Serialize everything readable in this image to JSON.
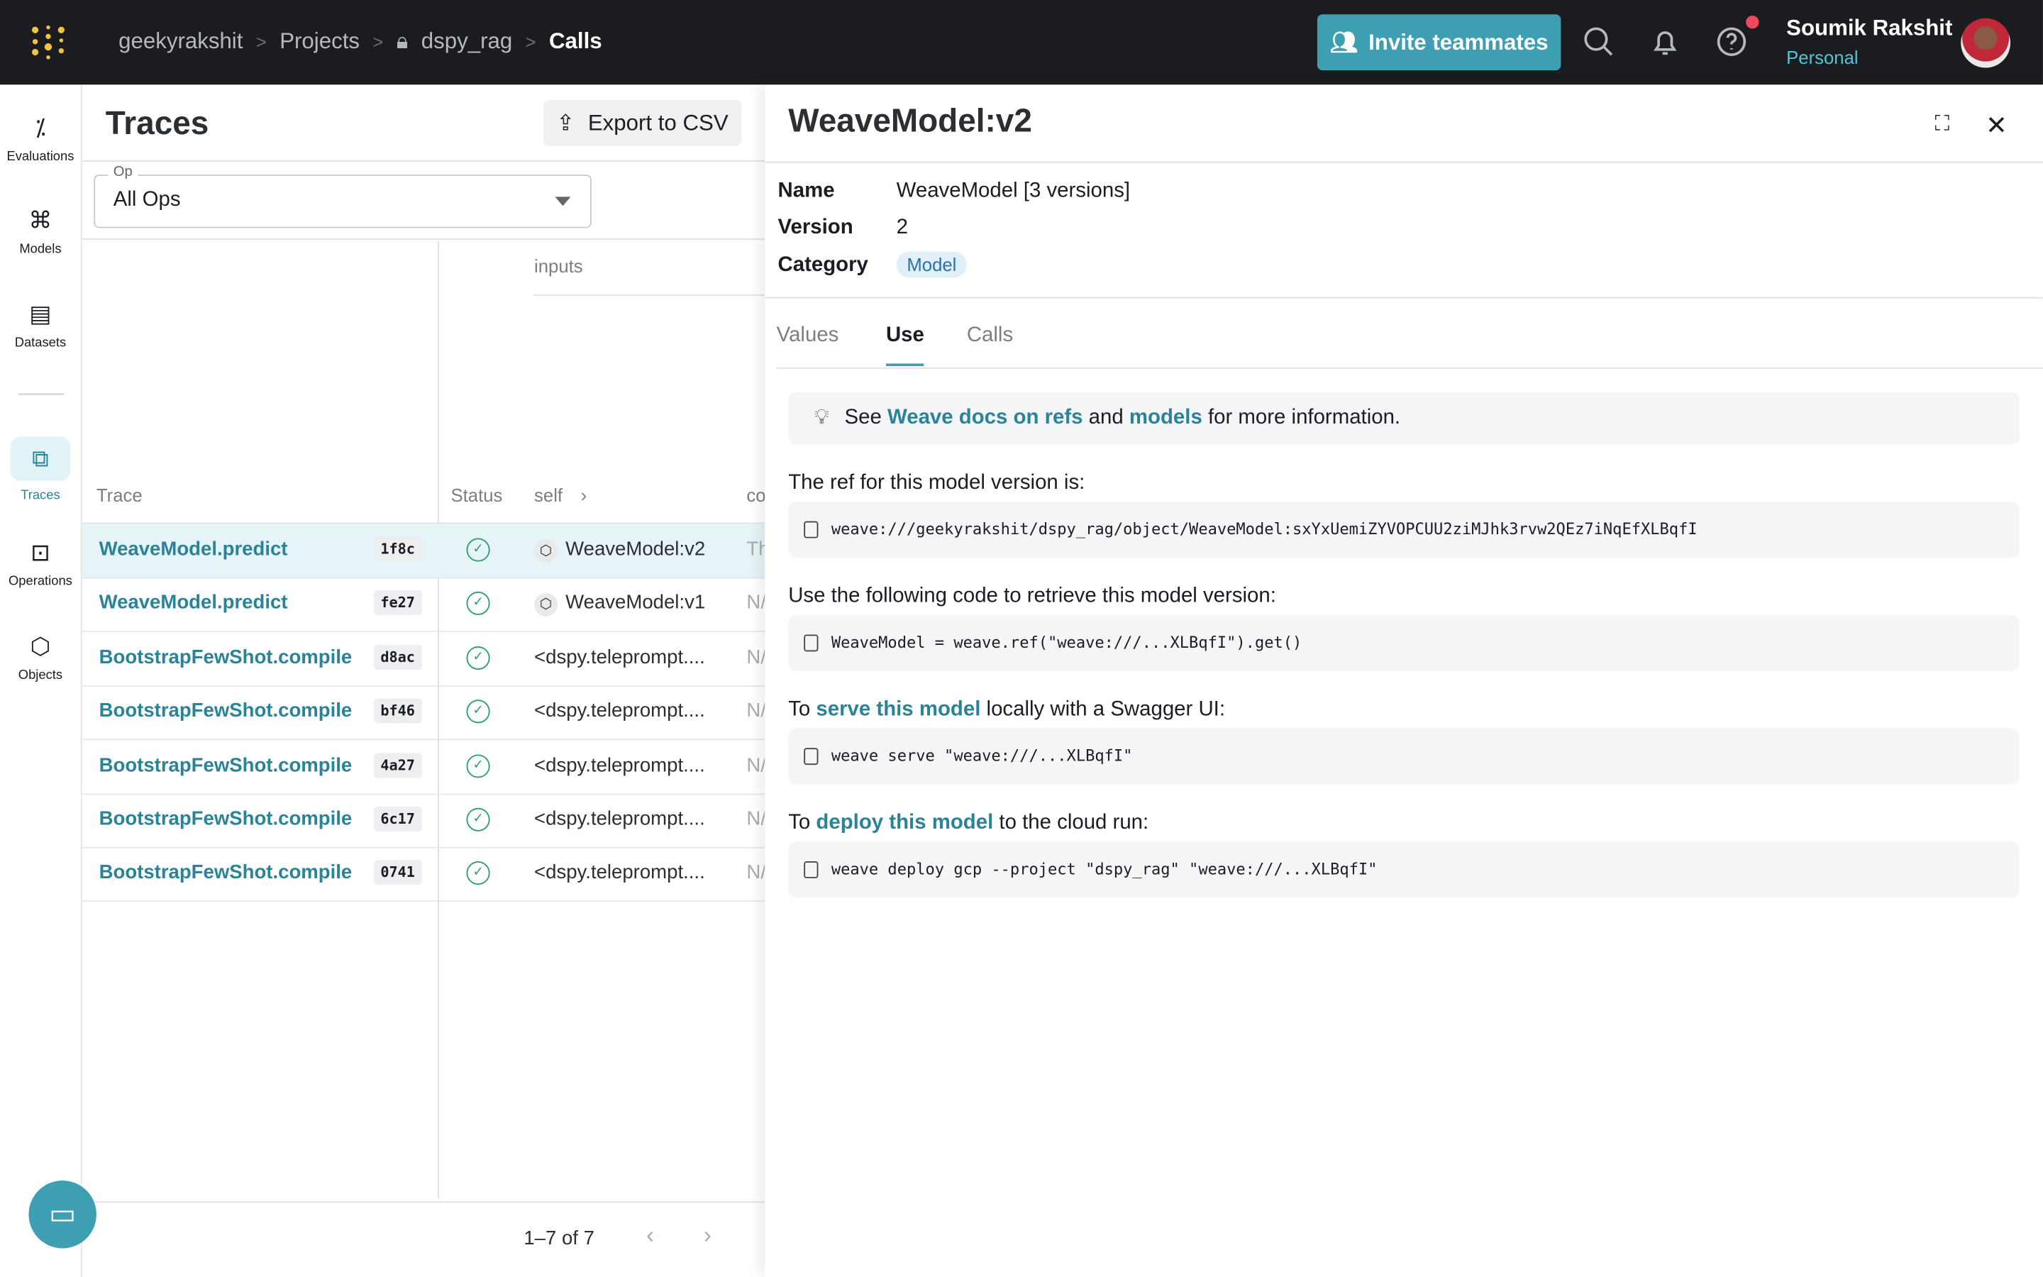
{
  "topbar": {
    "breadcrumbs": [
      "geekyrakshit",
      "Projects",
      "dspy_rag",
      "Calls"
    ],
    "invite_label": "Invite teammates",
    "user_name": "Soumik Rakshit",
    "user_sub": "Personal"
  },
  "sidebar": {
    "items": [
      {
        "label": "Evaluations",
        "icon": "evaluations-icon"
      },
      {
        "label": "Models",
        "icon": "models-icon"
      },
      {
        "label": "Datasets",
        "icon": "datasets-icon"
      },
      {
        "label": "Traces",
        "icon": "traces-icon",
        "active": true
      },
      {
        "label": "Operations",
        "icon": "operations-icon"
      },
      {
        "label": "Objects",
        "icon": "objects-icon"
      }
    ]
  },
  "traces": {
    "title": "Traces",
    "export_label": "Export to CSV",
    "op_label": "Op",
    "op_value": "All Ops",
    "columns": {
      "group_inputs": "inputs",
      "trace": "Trace",
      "status": "Status",
      "self": "self",
      "co": "co"
    },
    "rows": [
      {
        "name": "WeaveModel.predict",
        "id": "1f8c",
        "self": "WeaveModel:v2",
        "co": "Th",
        "selected": true,
        "ref": true
      },
      {
        "name": "WeaveModel.predict",
        "id": "fe27",
        "self": "WeaveModel:v1",
        "co": "N/",
        "ref": true
      },
      {
        "name": "BootstrapFewShot.compile",
        "id": "d8ac",
        "self": "<dspy.teleprompt....",
        "co": "N/"
      },
      {
        "name": "BootstrapFewShot.compile",
        "id": "bf46",
        "self": "<dspy.teleprompt....",
        "co": "N/"
      },
      {
        "name": "BootstrapFewShot.compile",
        "id": "4a27",
        "self": "<dspy.teleprompt....",
        "co": "N/"
      },
      {
        "name": "BootstrapFewShot.compile",
        "id": "6c17",
        "self": "<dspy.teleprompt....",
        "co": "N/"
      },
      {
        "name": "BootstrapFewShot.compile",
        "id": "0741",
        "self": "<dspy.teleprompt....",
        "co": "N/"
      }
    ],
    "pagination": "1–7 of 7"
  },
  "detail": {
    "title": "WeaveModel:v2",
    "name_label": "Name",
    "name_value": "WeaveModel [3 versions]",
    "version_label": "Version",
    "version_value": "2",
    "category_label": "Category",
    "category_value": "Model",
    "tabs": [
      "Values",
      "Use",
      "Calls"
    ],
    "active_tab": "Use",
    "info": {
      "pre": "See",
      "link1": "Weave docs on refs",
      "mid": "and",
      "link2": "models",
      "post": "for more information."
    },
    "ref_text": "The ref for this model version is:",
    "ref_code": "weave:///geekyrakshit/dspy_rag/object/WeaveModel:sxYxUemiZYVOPCUU2ziMJhk3rvw2QEz7iNqEfXLBqfI",
    "retrieve_text": "Use the following code to retrieve this model version:",
    "retrieve_code": "WeaveModel = weave.ref(\"weave:///...XLBqfI\").get()",
    "serve_pre": "To",
    "serve_link": "serve this model",
    "serve_post": "locally with a Swagger UI:",
    "serve_code": "weave serve \"weave:///...XLBqfI\"",
    "deploy_pre": "To",
    "deploy_link": "deploy this model",
    "deploy_post": "to the cloud run:",
    "deploy_code": "weave deploy gcp --project \"dspy_rag\" \"weave:///...XLBqfI\""
  },
  "colors": {
    "accent": "#3d9fb1",
    "link": "#2a8396",
    "topbar": "#1a1c1f"
  }
}
